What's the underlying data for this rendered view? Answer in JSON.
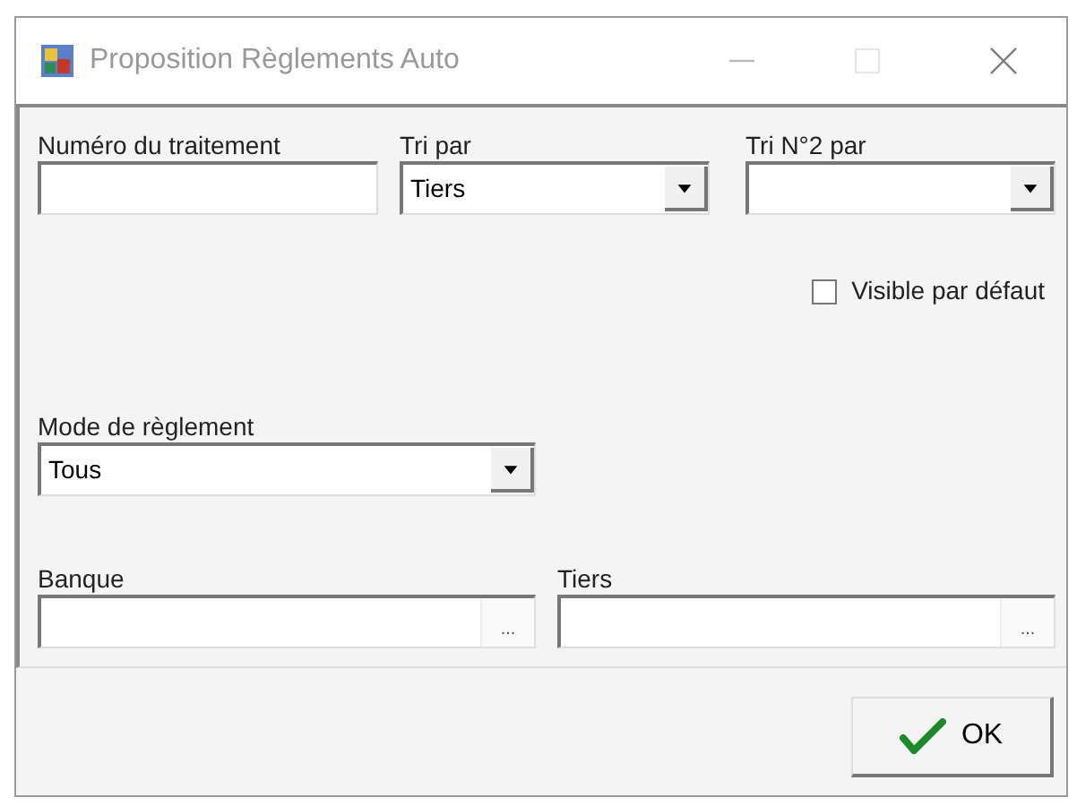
{
  "window": {
    "title": "Proposition Règlements Auto"
  },
  "fields": [
    {
      "kind": "text",
      "label": "Numéro du traitement"
    },
    {
      "kind": "combo",
      "label": "Tri par",
      "value": "Tiers"
    },
    {
      "kind": "combo",
      "label": "Tri N°2 par"
    }
  ],
  "visible_checkbox": {
    "label": "Visible par défaut",
    "checked": false
  },
  "payment_mode": {
    "label": "Mode de règlement",
    "value": "Tous"
  },
  "lookups": [
    {
      "label": "Banque",
      "button": "..."
    },
    {
      "label": "Tiers",
      "button": "..."
    }
  ],
  "ok_button": {
    "label": "OK"
  }
}
